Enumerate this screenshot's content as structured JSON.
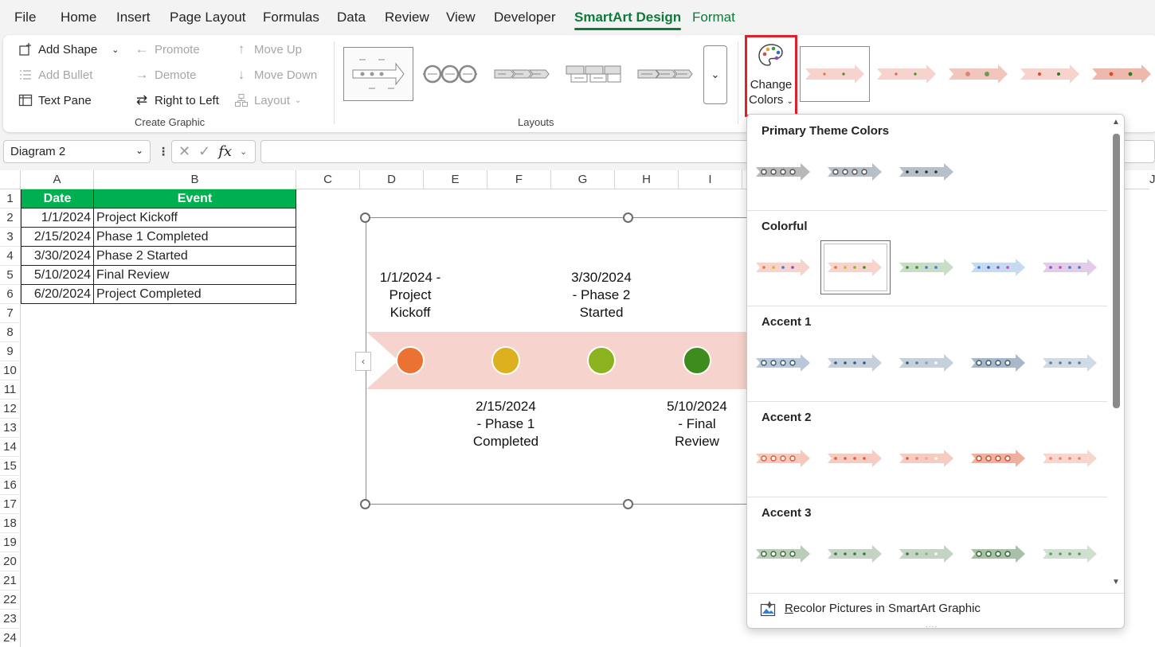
{
  "menu": {
    "tabs": [
      "File",
      "Home",
      "Insert",
      "Page Layout",
      "Formulas",
      "Data",
      "Review",
      "View",
      "Developer",
      "SmartArt Design",
      "Format"
    ],
    "active": "SmartArt Design"
  },
  "ribbon": {
    "create_graphic": {
      "add_shape": "Add Shape",
      "add_bullet": "Add Bullet",
      "text_pane": "Text Pane",
      "promote": "Promote",
      "demote": "Demote",
      "right_to_left": "Right to Left",
      "move_up": "Move Up",
      "move_down": "Move Down",
      "layout": "Layout",
      "label": "Create Graphic"
    },
    "layouts": {
      "label": "Layouts"
    },
    "change_colors": {
      "line1": "Change",
      "line2": "Colors"
    }
  },
  "formula_bar": {
    "name_box": "Diagram 2",
    "fx": "fx",
    "formula": ""
  },
  "sheet": {
    "columns": [
      "A",
      "B",
      "C",
      "D",
      "E",
      "F",
      "G",
      "H",
      "I"
    ],
    "last_column_partial": "J",
    "rows": [
      "1",
      "2",
      "3",
      "4",
      "5",
      "6",
      "7",
      "8",
      "9",
      "10",
      "11",
      "12",
      "13",
      "14",
      "15",
      "16",
      "17",
      "18",
      "19",
      "20",
      "21",
      "22",
      "23",
      "24"
    ],
    "table": {
      "headers": [
        "Date",
        "Event"
      ],
      "rows": [
        [
          "1/1/2024",
          "Project Kickoff"
        ],
        [
          "2/15/2024",
          "Phase 1 Completed"
        ],
        [
          "3/30/2024",
          "Phase 2 Started"
        ],
        [
          "5/10/2024",
          "Final Review"
        ],
        [
          "6/20/2024",
          "Project Completed"
        ]
      ],
      "header_color": "#00b050"
    }
  },
  "smartart": {
    "arrow_color": "#f6d3cc",
    "nodes": [
      {
        "label": "1/1/2024 - Project Kickoff",
        "lines": [
          "1/1/2024 -",
          "Project",
          "Kickoff"
        ],
        "color": "#eb7233",
        "position": "above"
      },
      {
        "label": "2/15/2024 - Phase 1 Completed",
        "lines": [
          "2/15/2024",
          "- Phase 1",
          "Completed"
        ],
        "color": "#dcb01f",
        "position": "below"
      },
      {
        "label": "3/30/2024 - Phase 2 Started",
        "lines": [
          "3/30/2024",
          "- Phase 2",
          "Started"
        ],
        "color": "#8cb21f",
        "position": "above"
      },
      {
        "label": "5/10/2024 - Final Review",
        "lines": [
          "5/10/2024",
          "- Final",
          "Review"
        ],
        "color": "#3e8c1d",
        "position": "below"
      }
    ]
  },
  "color_dropdown": {
    "sections": [
      {
        "title": "Primary Theme Colors",
        "count": 3
      },
      {
        "title": "Colorful",
        "count": 5,
        "selected_index": 1
      },
      {
        "title": "Accent 1",
        "count": 5
      },
      {
        "title": "Accent 2",
        "count": 5
      },
      {
        "title": "Accent 3",
        "count": 5
      }
    ],
    "footer": {
      "accel": "R",
      "rest": "ecolor Pictures in SmartArt Graphic"
    },
    "grip": "...."
  },
  "colors": {
    "accent_green": "#0e7a3a",
    "highlight_red": "#e0202a"
  }
}
